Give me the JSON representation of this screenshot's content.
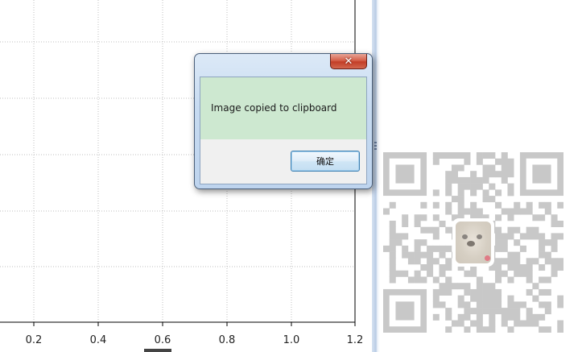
{
  "dialog": {
    "message": "Image copied to clipboard",
    "ok_label": "确定",
    "close_glyph": "✕"
  },
  "plot": {
    "x_tick_labels": [
      "0.2",
      "0.4",
      "0.6",
      "0.8",
      "1.0",
      "1.2"
    ],
    "grid_color": "#bfbfbf",
    "axis_color": "#000000"
  },
  "qr": {
    "module_color": "#c8c8c8",
    "center_logo": "pug-icon"
  },
  "colors": {
    "dialog_message_bg": "#cde8d0",
    "dialog_frame": "#c7dbf1",
    "close_button": "#c94a33",
    "ok_button_border": "#3c7fb1"
  }
}
